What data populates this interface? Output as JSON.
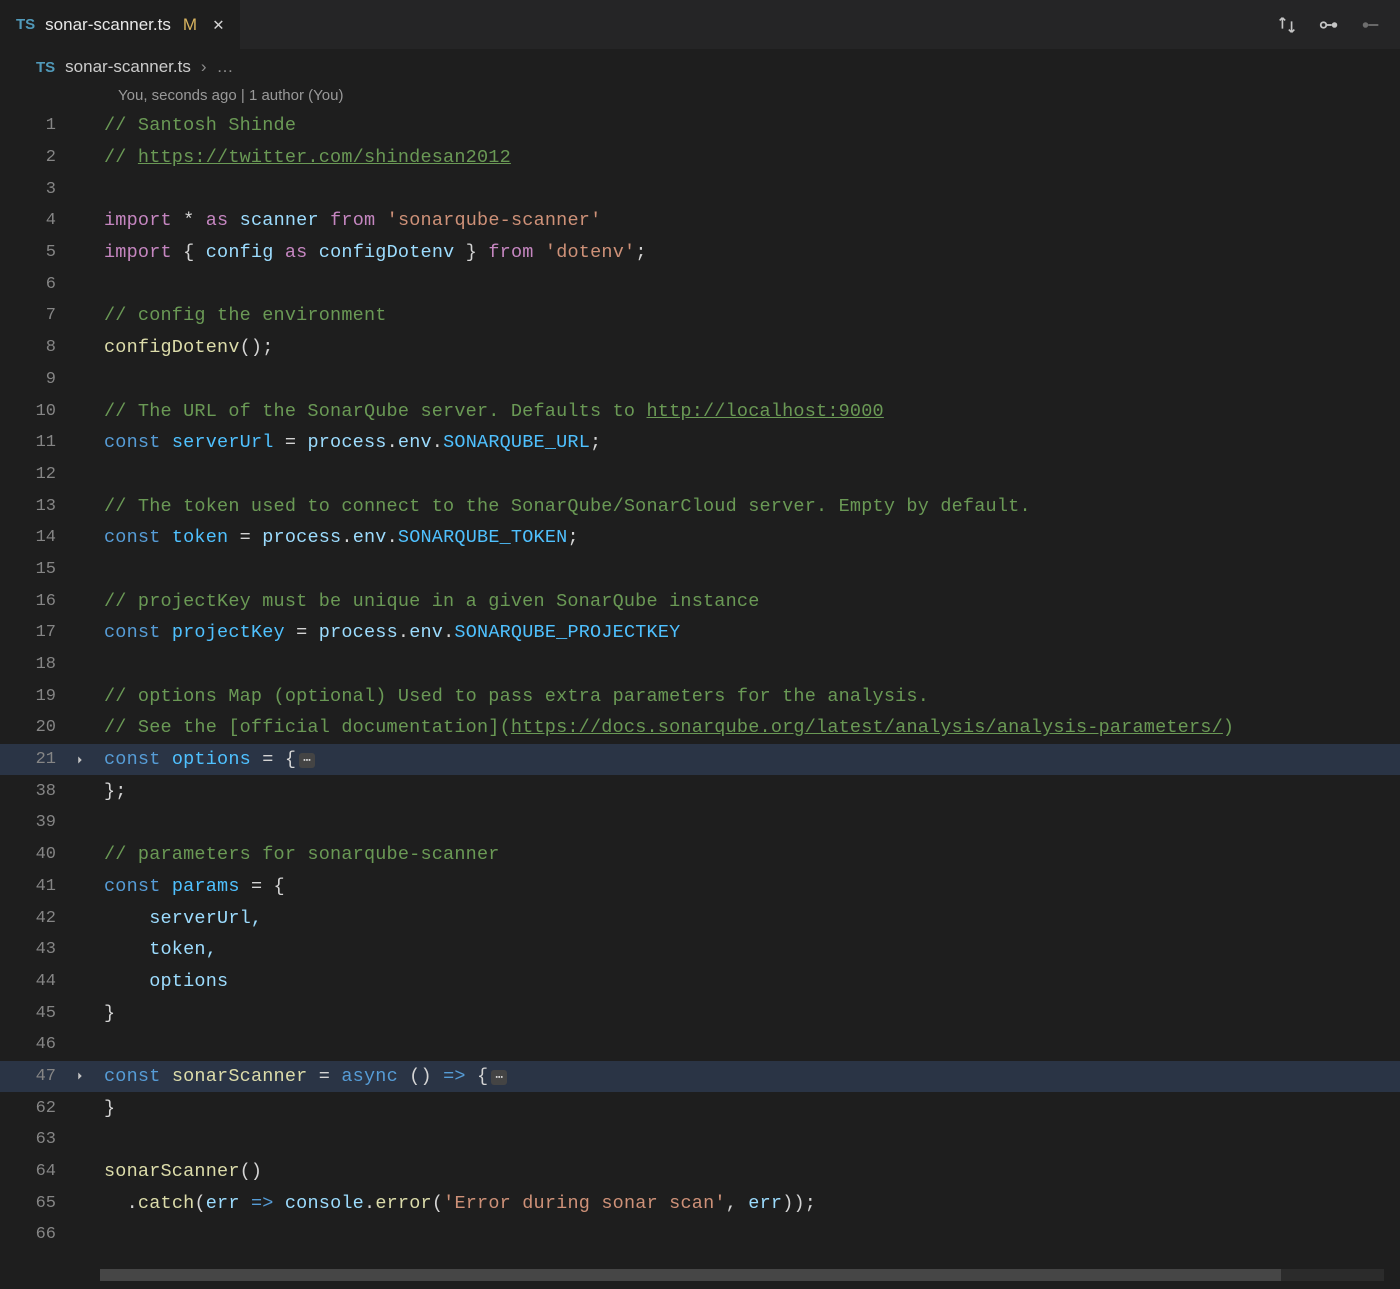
{
  "tab": {
    "icon": "TS",
    "filename": "sonar-scanner.ts",
    "modified_indicator": "M"
  },
  "breadcrumb": {
    "icon": "TS",
    "file": "sonar-scanner.ts",
    "sep": "›",
    "trail": "…"
  },
  "codelens": "You, seconds ago | 1 author (You)",
  "code": {
    "l1_comment": "// Santosh Shinde",
    "l2_comment_pre": "// ",
    "l2_link": "https://twitter.com/shindesan2012",
    "l4_import": "import",
    "l4_star": "*",
    "l4_as": "as",
    "l4_scanner": "scanner",
    "l4_from": "from",
    "l4_str": "'sonarqube-scanner'",
    "l5_import": "import",
    "l5_brace_o": "{",
    "l5_config": "config",
    "l5_as": "as",
    "l5_configDotenv": "configDotenv",
    "l5_brace_c": "}",
    "l5_from": "from",
    "l5_str": "'dotenv'",
    "l5_semi": ";",
    "l7_comment": "// config the environment",
    "l8_fn": "configDotenv",
    "l8_call": "();",
    "l10_comment_pre": "// The URL of the SonarQube server. Defaults to ",
    "l10_link": "http://localhost:9000",
    "l11_const": "const",
    "l11_name": "serverUrl",
    "l11_eq": " = ",
    "l11_proc": "process",
    "l11_dot1": ".",
    "l11_env": "env",
    "l11_dot2": ".",
    "l11_key": "SONARQUBE_URL",
    "l11_semi": ";",
    "l13_comment": "// The token used to connect to the SonarQube/SonarCloud server. Empty by default.",
    "l14_const": "const",
    "l14_name": "token",
    "l14_eq": " = ",
    "l14_proc": "process",
    "l14_dot1": ".",
    "l14_env": "env",
    "l14_dot2": ".",
    "l14_key": "SONARQUBE_TOKEN",
    "l14_semi": ";",
    "l16_comment": "// projectKey must be unique in a given SonarQube instance",
    "l17_const": "const",
    "l17_name": "projectKey",
    "l17_eq": " = ",
    "l17_proc": "process",
    "l17_dot1": ".",
    "l17_env": "env",
    "l17_dot2": ".",
    "l17_key": "SONARQUBE_PROJECTKEY",
    "l19_comment": "// options Map (optional) Used to pass extra parameters for the analysis.",
    "l20_comment_pre": "// See the [official documentation](",
    "l20_link": "https://docs.sonarqube.org/latest/analysis/analysis-parameters/",
    "l20_comment_post": ")",
    "l21_const": "const",
    "l21_name": "options",
    "l21_rest": " = {",
    "l21_dots": "⋯",
    "l38_close": "};",
    "l40_comment": "// parameters for sonarqube-scanner",
    "l41_const": "const",
    "l41_name": "params",
    "l41_rest": " = {",
    "l42": "    serverUrl,",
    "l43": "    token,",
    "l44": "    options",
    "l45": "}",
    "l47_const": "const",
    "l47_name": "sonarScanner",
    "l47_eq": " = ",
    "l47_async": "async",
    "l47_rest": " () ",
    "l47_arrow": "=>",
    "l47_brace": " {",
    "l47_dots": "⋯",
    "l62_close": "}",
    "l64_fn": "sonarScanner",
    "l64_call": "()",
    "l65_indent": "  ",
    "l65_dot": ".",
    "l65_catch": "catch",
    "l65_paren_o": "(",
    "l65_err": "err",
    "l65_arrow": " => ",
    "l65_console": "console",
    "l65_dot2": ".",
    "l65_error": "error",
    "l65_paren2_o": "(",
    "l65_str": "'Error during sonar scan'",
    "l65_comma": ", ",
    "l65_err2": "err",
    "l65_close": "));"
  },
  "line_numbers": [
    "1",
    "2",
    "3",
    "4",
    "5",
    "6",
    "7",
    "8",
    "9",
    "10",
    "11",
    "12",
    "13",
    "14",
    "15",
    "16",
    "17",
    "18",
    "19",
    "20",
    "21",
    "38",
    "39",
    "40",
    "41",
    "42",
    "43",
    "44",
    "45",
    "46",
    "47",
    "62",
    "63",
    "64",
    "65",
    "66"
  ]
}
